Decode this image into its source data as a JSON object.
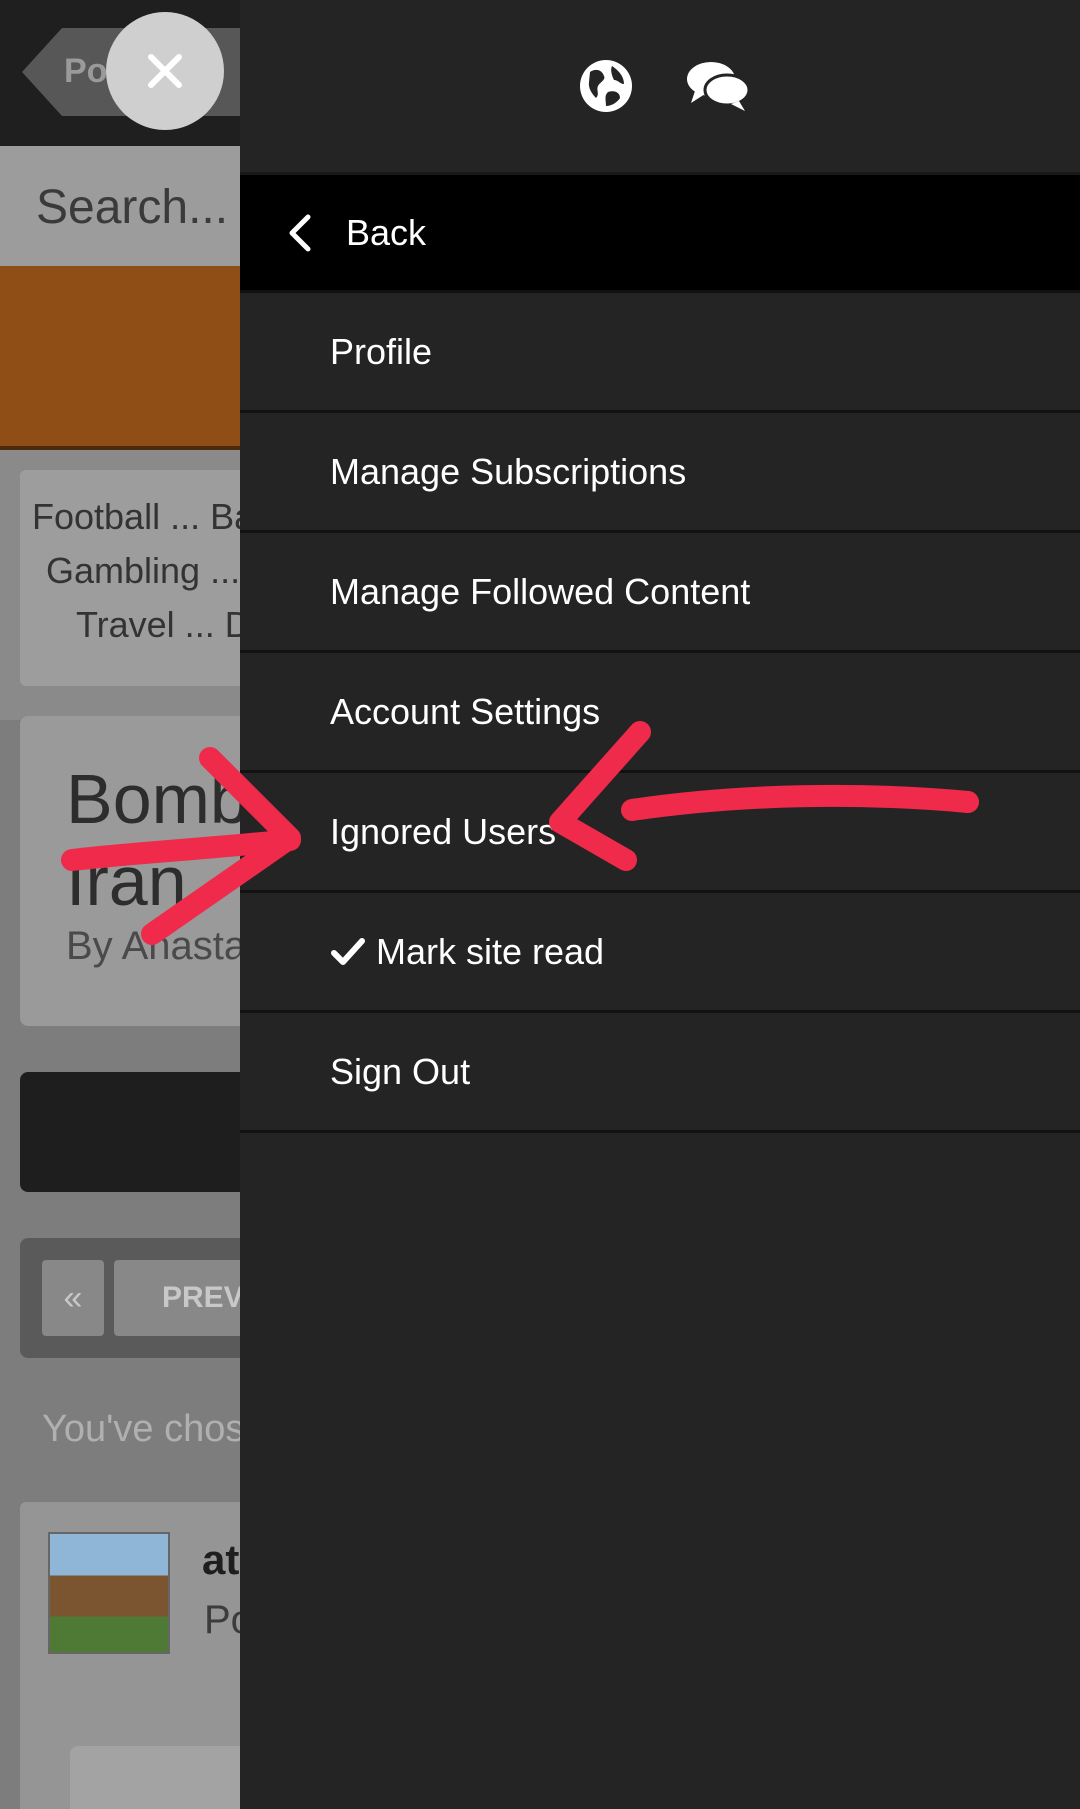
{
  "background": {
    "breadcrumb_text": "Po",
    "search_placeholder": "Search...",
    "tags": [
      "Football ... Ba",
      "Gambling ...",
      "Travel ... D"
    ],
    "article_title": "Bomb Iran",
    "article_author": "By Anasta",
    "pager_first": "«",
    "pager_prev": "PREV",
    "note_text": "You've chose",
    "poster_name": "at",
    "posted_label": "Po"
  },
  "header_icons": [
    "globe-icon",
    "chat-bubbles-icon"
  ],
  "menu": {
    "back_label": "Back",
    "items": [
      {
        "label": "Profile"
      },
      {
        "label": "Manage Subscriptions"
      },
      {
        "label": "Manage Followed Content"
      },
      {
        "label": "Account Settings"
      },
      {
        "label": "Ignored Users"
      },
      {
        "label": "Mark site read",
        "icon": "checkmark-icon"
      },
      {
        "label": "Sign Out"
      }
    ]
  },
  "colors": {
    "menu_bg": "#242424",
    "back_row_bg": "#000000",
    "annotation": "#ef2a4a"
  }
}
